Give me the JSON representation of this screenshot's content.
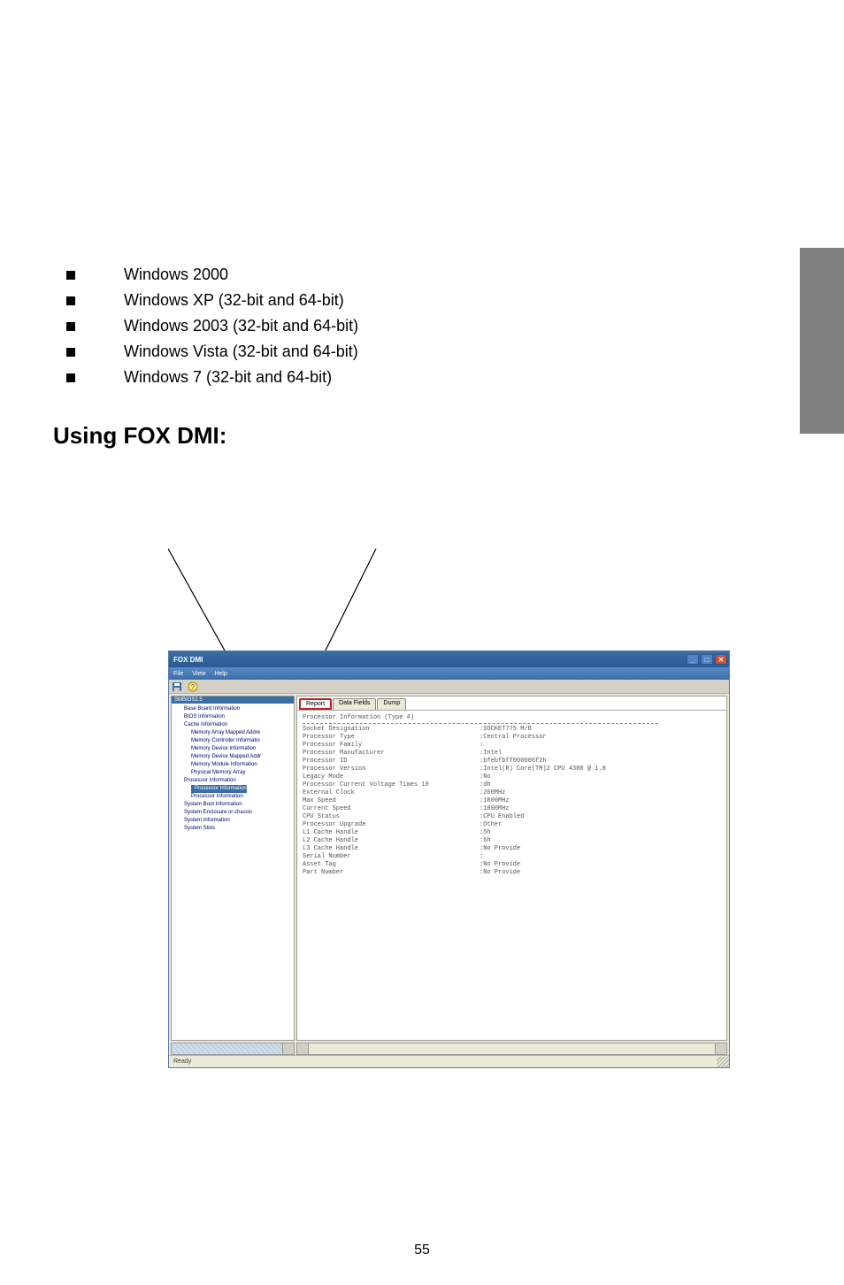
{
  "bullets": [
    "Windows 2000",
    "Windows XP (32-bit and 64-bit)",
    "Windows 2003 (32-bit and 64-bit)",
    "Windows Vista (32-bit and 64-bit)",
    "Windows 7 (32-bit and 64-bit)"
  ],
  "heading": "Using FOX DMI:",
  "window": {
    "title": "FOX DMI",
    "menus": [
      "File",
      "View",
      "Help"
    ],
    "status": "Ready"
  },
  "tree": {
    "header": "SMBIOS2.5",
    "items": [
      {
        "label": "Base Board Information",
        "level": 2
      },
      {
        "label": "BIOS Information",
        "level": 2
      },
      {
        "label": "Cache Information",
        "level": 2
      },
      {
        "label": "Memory Array Mapped Addre",
        "level": 3
      },
      {
        "label": "Memory Controller Informatio",
        "level": 3
      },
      {
        "label": "Memory Device Information",
        "level": 3
      },
      {
        "label": "Memory Device Mapped Addr",
        "level": 3
      },
      {
        "label": "Memory Module Information",
        "level": 3
      },
      {
        "label": "Physical Memory Array",
        "level": 3
      },
      {
        "label": "Processor Information",
        "level": 2
      },
      {
        "label": "Processor Information",
        "level": 3,
        "selected": true
      },
      {
        "label": "Processor Information",
        "level": 3
      },
      {
        "label": "System Boot Information",
        "level": 2
      },
      {
        "label": "System Enclosure or chassis",
        "level": 2
      },
      {
        "label": "System Information",
        "level": 2
      },
      {
        "label": "System Slots",
        "level": 2
      }
    ]
  },
  "tabs": [
    "Report",
    "Data Fields",
    "Dump"
  ],
  "report": {
    "title": "Processor Information (Type 4)",
    "rows": [
      {
        "k": "Socket Designation",
        "v": ":SOCKET775 M/B"
      },
      {
        "k": "Processor Type",
        "v": ":Central Processor"
      },
      {
        "k": "Processor Family",
        "v": ":"
      },
      {
        "k": "Processor Manufacturer",
        "v": ":Intel"
      },
      {
        "k": "Processor ID",
        "v": ":bfebfbff000006f2h"
      },
      {
        "k": "Processor Version",
        "v": ":Intel(R) Core(TM)2 CPU        4300 @ 1.8"
      },
      {
        "k": "Legacy Mode",
        "v": ":No"
      },
      {
        "k": "Processor Current Voltage Times 10",
        "v": ":dh"
      },
      {
        "k": "External Clock",
        "v": ":200MHz"
      },
      {
        "k": "Max Speed",
        "v": ":1800MHz"
      },
      {
        "k": "Current Speed",
        "v": ":1800MHz"
      },
      {
        "k": "CPU Status",
        "v": ":CPU Enabled"
      },
      {
        "k": "Processor Upgrade",
        "v": ":Other"
      },
      {
        "k": "L1 Cache Handle",
        "v": ":5h"
      },
      {
        "k": "L2 Cache Handle",
        "v": ":6h"
      },
      {
        "k": "L3 Cache Handle",
        "v": ":No Provide"
      },
      {
        "k": "Serial Number",
        "v": ":"
      },
      {
        "k": "Asset Tag",
        "v": ":No Provide"
      },
      {
        "k": "Part Number",
        "v": ":No Provide"
      }
    ]
  },
  "page_number": "55"
}
